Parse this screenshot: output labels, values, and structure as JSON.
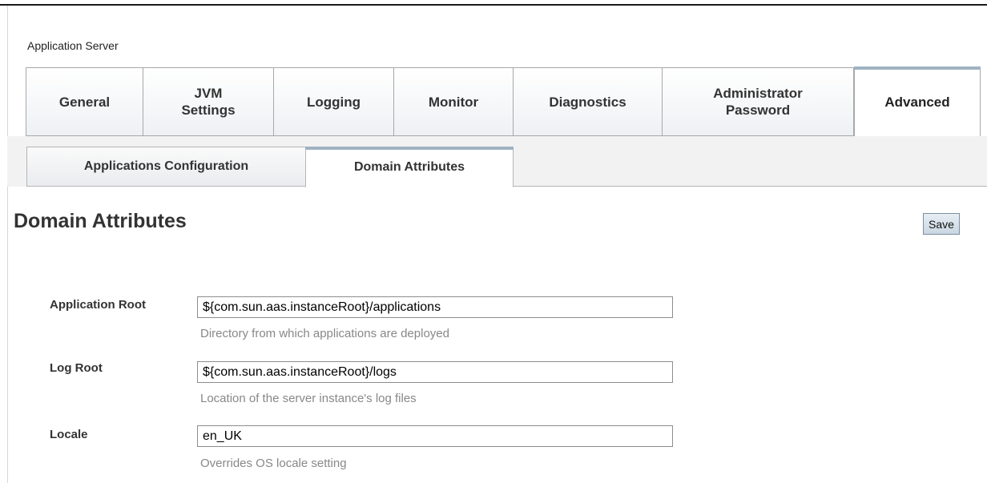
{
  "breadcrumb": "Application Server",
  "main_tabs": [
    {
      "label": "General"
    },
    {
      "label": "JVM\nSettings"
    },
    {
      "label": "Logging"
    },
    {
      "label": "Monitor"
    },
    {
      "label": "Diagnostics"
    },
    {
      "label": "Administrator\nPassword"
    },
    {
      "label": "Advanced",
      "selected": true
    }
  ],
  "sub_tabs": [
    {
      "label": "Applications Configuration"
    },
    {
      "label": "Domain Attributes",
      "selected": true
    }
  ],
  "page_title": "Domain Attributes",
  "save_label": "Save",
  "fields": [
    {
      "label": "Application Root",
      "value": "${com.sun.aas.instanceRoot}/applications",
      "help": "Directory from which applications are deployed"
    },
    {
      "label": "Log Root",
      "value": "${com.sun.aas.instanceRoot}/logs",
      "help": "Location of the server instance's log files"
    },
    {
      "label": "Locale",
      "value": "en_UK",
      "help": "Overrides OS locale setting"
    }
  ],
  "colors": {
    "tab_accent": "#9fb2c2",
    "help_text": "#888888",
    "button_border": "#7b8fa0"
  }
}
